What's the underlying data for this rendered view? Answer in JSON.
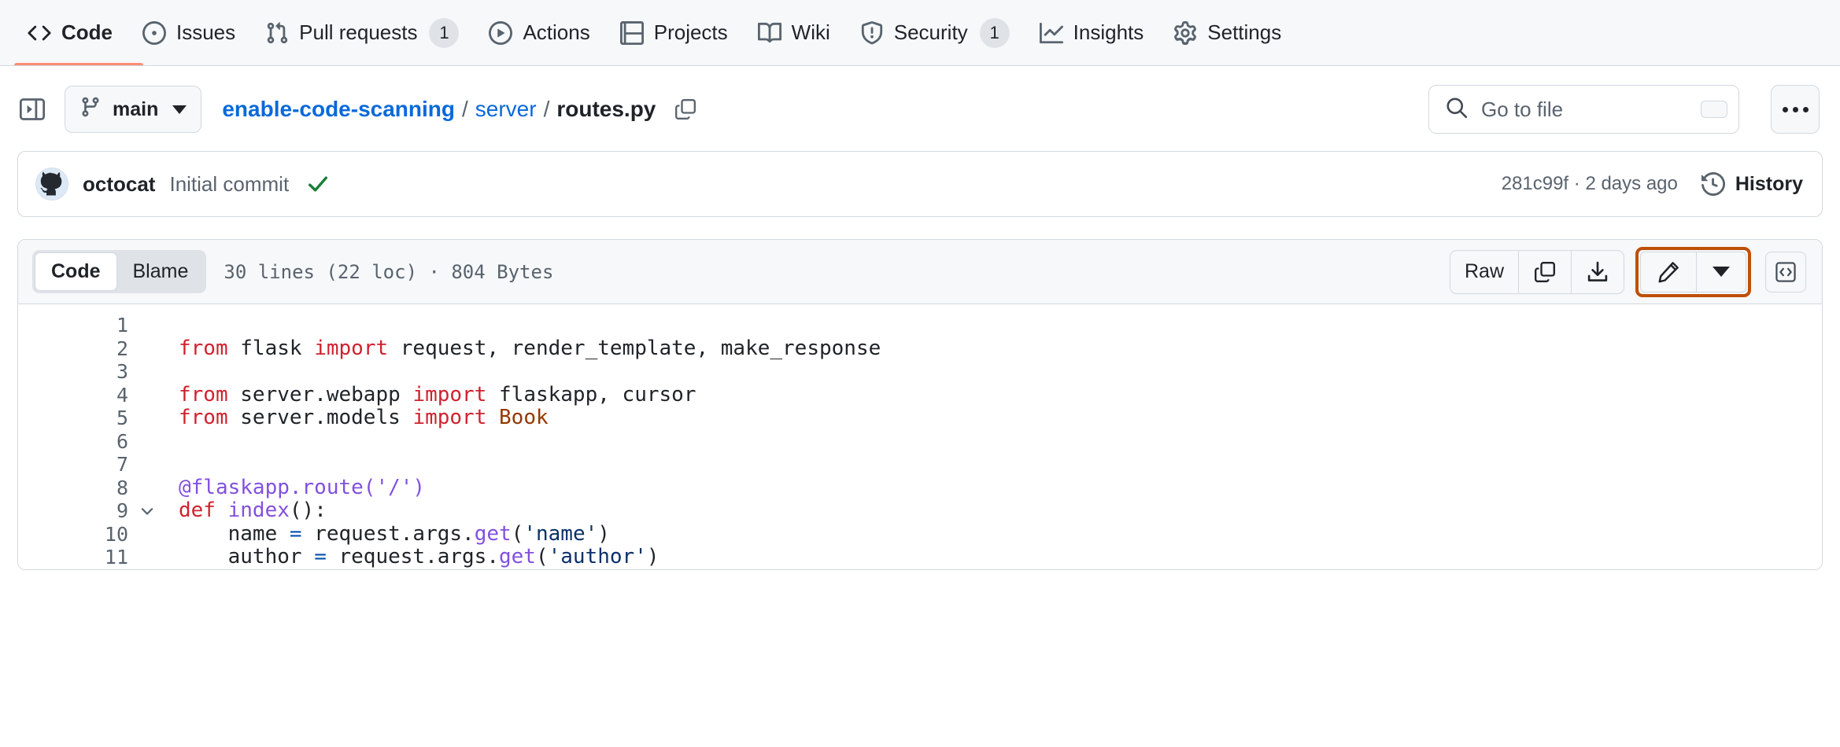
{
  "repo_nav": {
    "items": [
      {
        "label": "Code",
        "icon": "code-icon",
        "active": true,
        "count": null
      },
      {
        "label": "Issues",
        "icon": "issue-icon",
        "active": false,
        "count": null
      },
      {
        "label": "Pull requests",
        "icon": "git-pull-icon",
        "active": false,
        "count": "1"
      },
      {
        "label": "Actions",
        "icon": "play-icon",
        "active": false,
        "count": null
      },
      {
        "label": "Projects",
        "icon": "table-icon",
        "active": false,
        "count": null
      },
      {
        "label": "Wiki",
        "icon": "book-icon",
        "active": false,
        "count": null
      },
      {
        "label": "Security",
        "icon": "shield-icon",
        "active": false,
        "count": "1"
      },
      {
        "label": "Insights",
        "icon": "graph-icon",
        "active": false,
        "count": null
      },
      {
        "label": "Settings",
        "icon": "gear-icon",
        "active": false,
        "count": null
      }
    ],
    "active_underline_color": "#fd8c73"
  },
  "file_header": {
    "sidebar_toggle_icon": "sidebar-expand-icon",
    "branch": {
      "name": "main",
      "icon": "git-branch-icon"
    },
    "breadcrumb": {
      "repo": "enable-code-scanning",
      "separator": "/",
      "folder": "server",
      "file": "routes.py",
      "copy_icon": "copy-path-icon"
    },
    "search": {
      "placeholder": "Go to file",
      "icon": "search-icon",
      "shortcut_key": "/"
    },
    "more_menu_icon": "kebab-horizontal-icon"
  },
  "commit": {
    "avatar_alt": "octocat-avatar",
    "author": "octocat",
    "message": "Initial commit",
    "status_icon": "check-icon",
    "status_color": "#1a7f37",
    "sha": "281c99f",
    "dot": "·",
    "relative_time": "2 days ago",
    "history_label": "History",
    "history_icon": "history-icon"
  },
  "code_toolbar": {
    "tabs": [
      {
        "label": "Code",
        "active": true
      },
      {
        "label": "Blame",
        "active": false
      }
    ],
    "file_meta": "30 lines (22 loc) · 804 Bytes",
    "raw_label": "Raw",
    "copy_icon": "copy-raw-icon",
    "download_icon": "download-icon",
    "edit_icon": "pencil-edit-icon",
    "edit_caret_icon": "chevron-down-icon",
    "symbols_icon": "code-symbols-icon",
    "highlight_color": "#bf5008"
  },
  "code": {
    "language": "python",
    "lines": [
      {
        "num": "1",
        "fold": false,
        "tokens": []
      },
      {
        "num": "2",
        "fold": false,
        "tokens": [
          {
            "t": "from",
            "c": "k"
          },
          {
            "t": " flask ",
            "c": ""
          },
          {
            "t": "import",
            "c": "k"
          },
          {
            "t": " request, render_template, make_response",
            "c": ""
          }
        ]
      },
      {
        "num": "3",
        "fold": false,
        "tokens": []
      },
      {
        "num": "4",
        "fold": false,
        "tokens": [
          {
            "t": "from",
            "c": "k"
          },
          {
            "t": " server.webapp ",
            "c": ""
          },
          {
            "t": "import",
            "c": "k"
          },
          {
            "t": " flaskapp, cursor",
            "c": ""
          }
        ]
      },
      {
        "num": "5",
        "fold": false,
        "tokens": [
          {
            "t": "from",
            "c": "k"
          },
          {
            "t": " server.models ",
            "c": ""
          },
          {
            "t": "import",
            "c": "k"
          },
          {
            "t": " ",
            "c": ""
          },
          {
            "t": "Book",
            "c": "t"
          }
        ]
      },
      {
        "num": "6",
        "fold": false,
        "tokens": []
      },
      {
        "num": "7",
        "fold": false,
        "tokens": []
      },
      {
        "num": "8",
        "fold": false,
        "tokens": [
          {
            "t": "@flaskapp.route(",
            "c": "fn"
          },
          {
            "t": "'/'",
            "c": "fn"
          },
          {
            "t": ")",
            "c": "fn"
          }
        ]
      },
      {
        "num": "9",
        "fold": true,
        "tokens": [
          {
            "t": "def",
            "c": "k"
          },
          {
            "t": " ",
            "c": ""
          },
          {
            "t": "index",
            "c": "fn"
          },
          {
            "t": "():",
            "c": ""
          }
        ]
      },
      {
        "num": "10",
        "fold": false,
        "tokens": [
          {
            "t": "    name ",
            "c": ""
          },
          {
            "t": "=",
            "c": "op"
          },
          {
            "t": " request.args.",
            "c": ""
          },
          {
            "t": "get",
            "c": "fn"
          },
          {
            "t": "(",
            "c": ""
          },
          {
            "t": "'name'",
            "c": "s"
          },
          {
            "t": ")",
            "c": ""
          }
        ]
      },
      {
        "num": "11",
        "fold": false,
        "tokens": [
          {
            "t": "    author ",
            "c": ""
          },
          {
            "t": "=",
            "c": "op"
          },
          {
            "t": " request.args.",
            "c": ""
          },
          {
            "t": "get",
            "c": "fn"
          },
          {
            "t": "(",
            "c": ""
          },
          {
            "t": "'author'",
            "c": "s"
          },
          {
            "t": ")",
            "c": ""
          }
        ]
      }
    ]
  }
}
